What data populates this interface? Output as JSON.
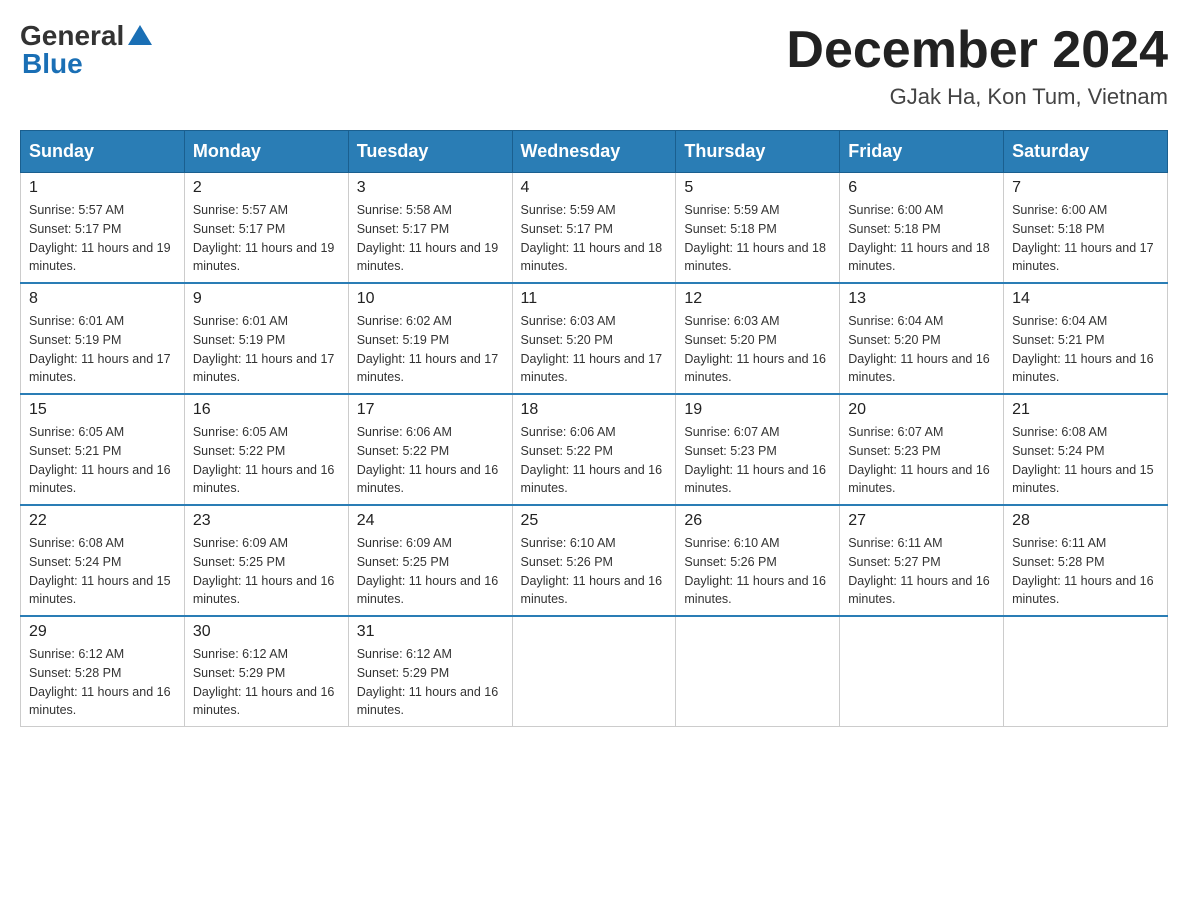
{
  "logo": {
    "general": "General",
    "blue": "Blue",
    "triangle": "▲"
  },
  "title": "December 2024",
  "subtitle": "GJak Ha, Kon Tum, Vietnam",
  "headers": [
    "Sunday",
    "Monday",
    "Tuesday",
    "Wednesday",
    "Thursday",
    "Friday",
    "Saturday"
  ],
  "weeks": [
    [
      {
        "day": "1",
        "sunrise": "5:57 AM",
        "sunset": "5:17 PM",
        "daylight": "11 hours and 19 minutes."
      },
      {
        "day": "2",
        "sunrise": "5:57 AM",
        "sunset": "5:17 PM",
        "daylight": "11 hours and 19 minutes."
      },
      {
        "day": "3",
        "sunrise": "5:58 AM",
        "sunset": "5:17 PM",
        "daylight": "11 hours and 19 minutes."
      },
      {
        "day": "4",
        "sunrise": "5:59 AM",
        "sunset": "5:17 PM",
        "daylight": "11 hours and 18 minutes."
      },
      {
        "day": "5",
        "sunrise": "5:59 AM",
        "sunset": "5:18 PM",
        "daylight": "11 hours and 18 minutes."
      },
      {
        "day": "6",
        "sunrise": "6:00 AM",
        "sunset": "5:18 PM",
        "daylight": "11 hours and 18 minutes."
      },
      {
        "day": "7",
        "sunrise": "6:00 AM",
        "sunset": "5:18 PM",
        "daylight": "11 hours and 17 minutes."
      }
    ],
    [
      {
        "day": "8",
        "sunrise": "6:01 AM",
        "sunset": "5:19 PM",
        "daylight": "11 hours and 17 minutes."
      },
      {
        "day": "9",
        "sunrise": "6:01 AM",
        "sunset": "5:19 PM",
        "daylight": "11 hours and 17 minutes."
      },
      {
        "day": "10",
        "sunrise": "6:02 AM",
        "sunset": "5:19 PM",
        "daylight": "11 hours and 17 minutes."
      },
      {
        "day": "11",
        "sunrise": "6:03 AM",
        "sunset": "5:20 PM",
        "daylight": "11 hours and 17 minutes."
      },
      {
        "day": "12",
        "sunrise": "6:03 AM",
        "sunset": "5:20 PM",
        "daylight": "11 hours and 16 minutes."
      },
      {
        "day": "13",
        "sunrise": "6:04 AM",
        "sunset": "5:20 PM",
        "daylight": "11 hours and 16 minutes."
      },
      {
        "day": "14",
        "sunrise": "6:04 AM",
        "sunset": "5:21 PM",
        "daylight": "11 hours and 16 minutes."
      }
    ],
    [
      {
        "day": "15",
        "sunrise": "6:05 AM",
        "sunset": "5:21 PM",
        "daylight": "11 hours and 16 minutes."
      },
      {
        "day": "16",
        "sunrise": "6:05 AM",
        "sunset": "5:22 PM",
        "daylight": "11 hours and 16 minutes."
      },
      {
        "day": "17",
        "sunrise": "6:06 AM",
        "sunset": "5:22 PM",
        "daylight": "11 hours and 16 minutes."
      },
      {
        "day": "18",
        "sunrise": "6:06 AM",
        "sunset": "5:22 PM",
        "daylight": "11 hours and 16 minutes."
      },
      {
        "day": "19",
        "sunrise": "6:07 AM",
        "sunset": "5:23 PM",
        "daylight": "11 hours and 16 minutes."
      },
      {
        "day": "20",
        "sunrise": "6:07 AM",
        "sunset": "5:23 PM",
        "daylight": "11 hours and 16 minutes."
      },
      {
        "day": "21",
        "sunrise": "6:08 AM",
        "sunset": "5:24 PM",
        "daylight": "11 hours and 15 minutes."
      }
    ],
    [
      {
        "day": "22",
        "sunrise": "6:08 AM",
        "sunset": "5:24 PM",
        "daylight": "11 hours and 15 minutes."
      },
      {
        "day": "23",
        "sunrise": "6:09 AM",
        "sunset": "5:25 PM",
        "daylight": "11 hours and 16 minutes."
      },
      {
        "day": "24",
        "sunrise": "6:09 AM",
        "sunset": "5:25 PM",
        "daylight": "11 hours and 16 minutes."
      },
      {
        "day": "25",
        "sunrise": "6:10 AM",
        "sunset": "5:26 PM",
        "daylight": "11 hours and 16 minutes."
      },
      {
        "day": "26",
        "sunrise": "6:10 AM",
        "sunset": "5:26 PM",
        "daylight": "11 hours and 16 minutes."
      },
      {
        "day": "27",
        "sunrise": "6:11 AM",
        "sunset": "5:27 PM",
        "daylight": "11 hours and 16 minutes."
      },
      {
        "day": "28",
        "sunrise": "6:11 AM",
        "sunset": "5:28 PM",
        "daylight": "11 hours and 16 minutes."
      }
    ],
    [
      {
        "day": "29",
        "sunrise": "6:12 AM",
        "sunset": "5:28 PM",
        "daylight": "11 hours and 16 minutes."
      },
      {
        "day": "30",
        "sunrise": "6:12 AM",
        "sunset": "5:29 PM",
        "daylight": "11 hours and 16 minutes."
      },
      {
        "day": "31",
        "sunrise": "6:12 AM",
        "sunset": "5:29 PM",
        "daylight": "11 hours and 16 minutes."
      },
      null,
      null,
      null,
      null
    ]
  ]
}
